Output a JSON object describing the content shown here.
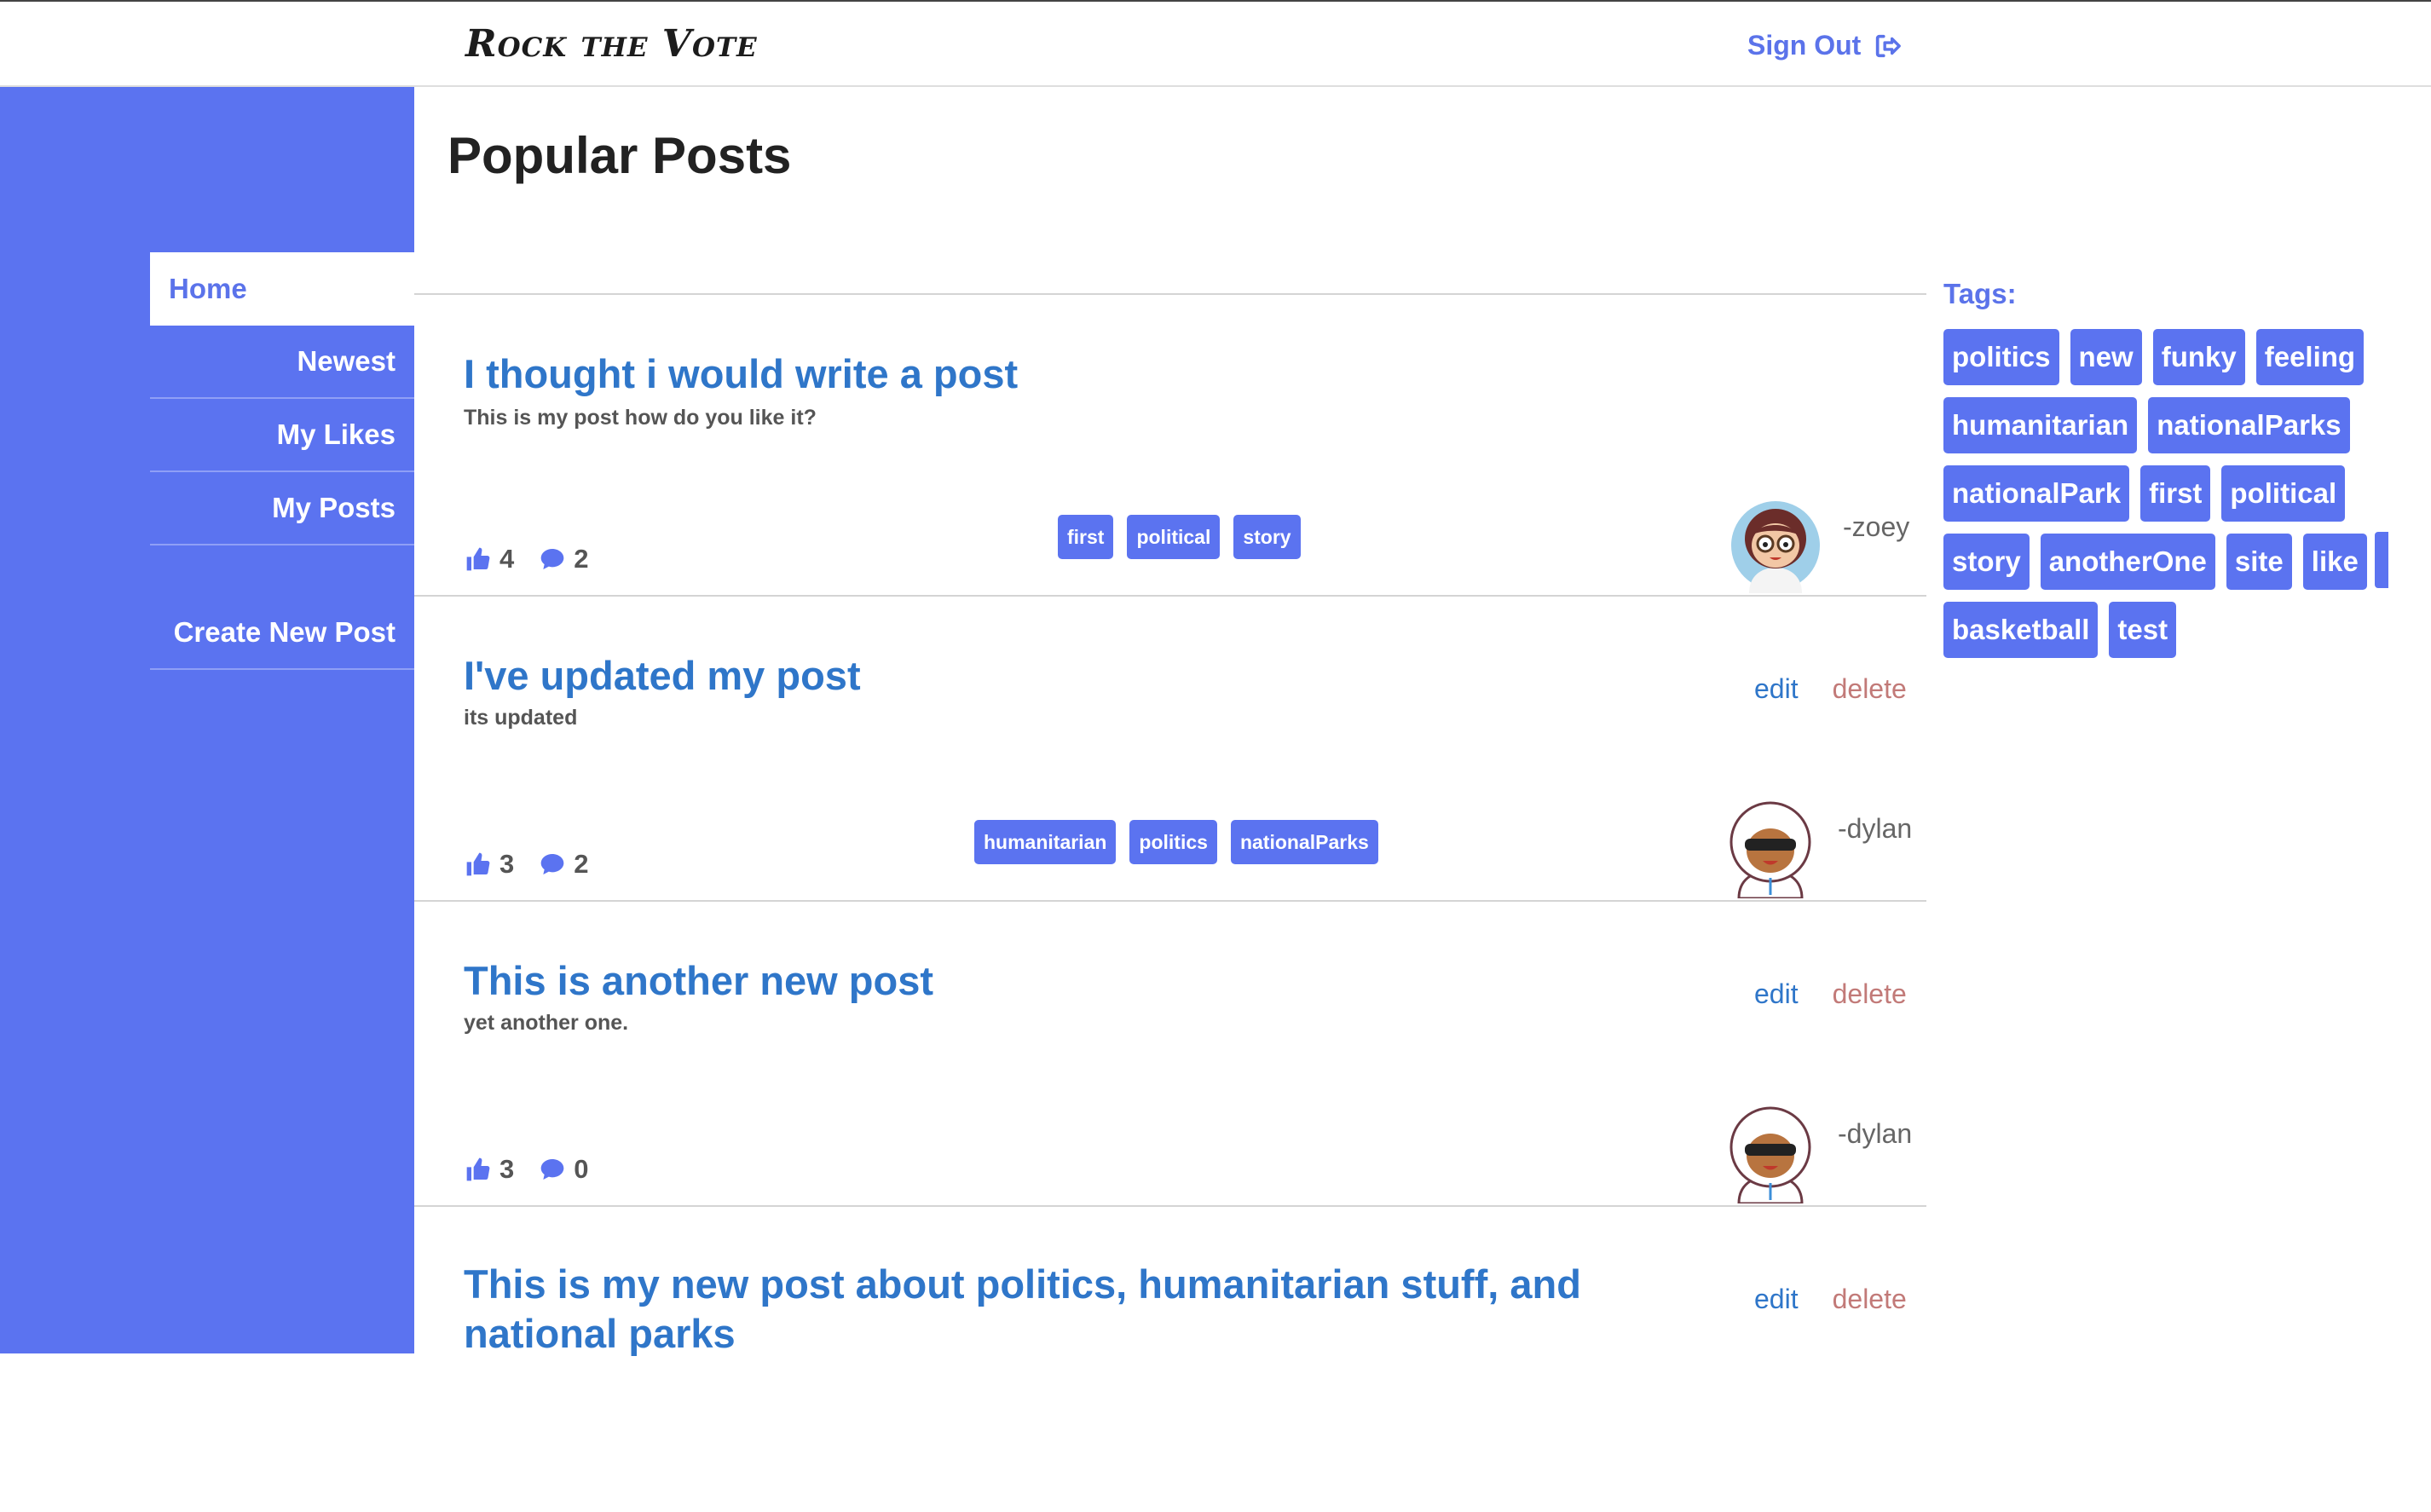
{
  "app": {
    "title": "Rock the Vote",
    "signout_label": "Sign Out"
  },
  "sidebar": {
    "items": [
      {
        "label": "Home",
        "active": true
      },
      {
        "label": "Newest"
      },
      {
        "label": "My Likes"
      },
      {
        "label": "My Posts"
      }
    ],
    "create_label": "Create New Post"
  },
  "main": {
    "title": "Popular Posts"
  },
  "posts": [
    {
      "title": "I thought i would write a post",
      "subtitle": "This is my post how do you like it?",
      "likes": "4",
      "comments": "2",
      "tags": [
        "first",
        "political",
        "story"
      ],
      "author": "-zoey",
      "editable": false
    },
    {
      "title": "I've updated my post",
      "subtitle": "its updated",
      "likes": "3",
      "comments": "2",
      "tags": [
        "humanitarian",
        "politics",
        "nationalParks"
      ],
      "author": "-dylan",
      "editable": true
    },
    {
      "title": "This is another new post",
      "subtitle": "yet another one.",
      "likes": "3",
      "comments": "0",
      "tags": [],
      "author": "-dylan",
      "editable": true
    },
    {
      "title": "This is my new post about politics, humanitarian stuff, and national parks",
      "subtitle": "",
      "likes": "",
      "comments": "",
      "tags": [],
      "author": "",
      "editable": true
    }
  ],
  "actions": {
    "edit_label": "edit",
    "delete_label": "delete"
  },
  "tags": {
    "label": "Tags:",
    "items": [
      "politics",
      "new",
      "funky",
      "feeling",
      "humanitarian",
      "nationalParks",
      "nationalPark",
      "first",
      "political",
      "story",
      "anotherOne",
      "site",
      "like",
      "basketball",
      "test"
    ]
  },
  "colors": {
    "accent": "#5b73f0",
    "link": "#2f76c9",
    "delete": "#c27a78"
  },
  "icons": [
    "sign-out-icon",
    "thumbs-up-icon",
    "comment-icon"
  ]
}
